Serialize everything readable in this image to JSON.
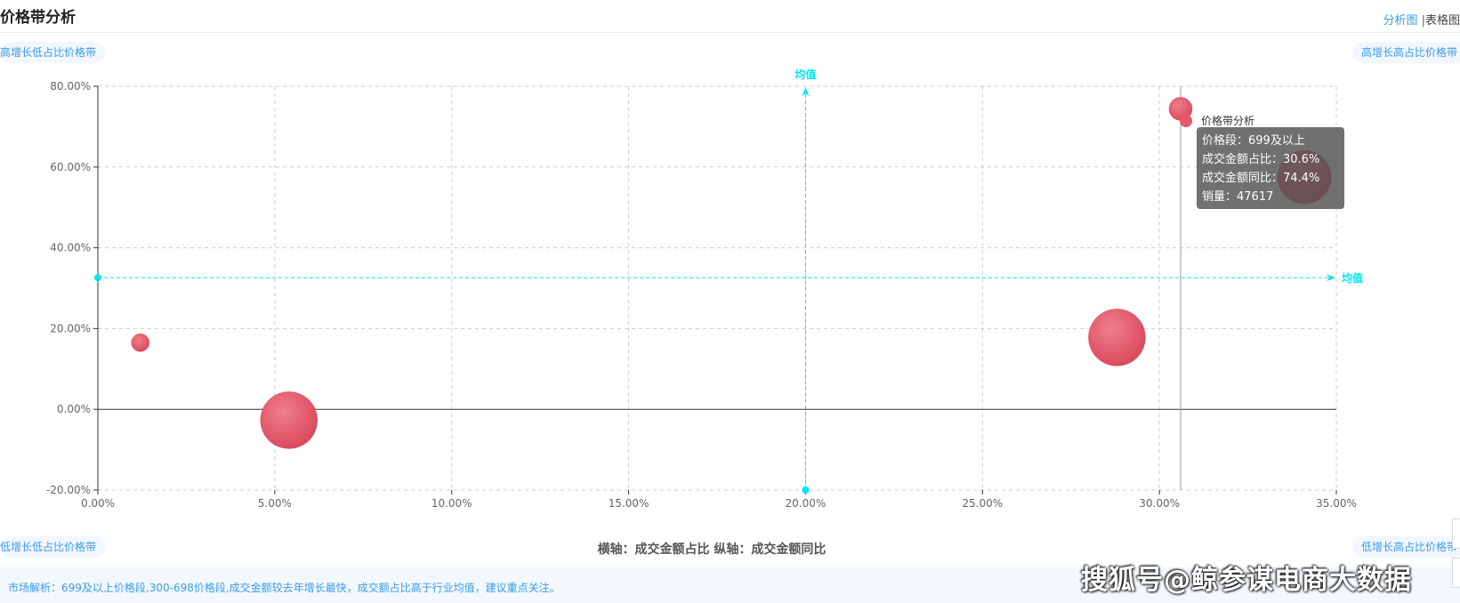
{
  "header": {
    "title": "价格带分析",
    "view_analysis": "分析图",
    "view_sep": "|",
    "view_table": "表格图"
  },
  "quadrants": {
    "top_left": "高增长低占比价格带",
    "top_right": "高增长高占比价格带",
    "bottom_left": "低增长低占比价格带",
    "bottom_right": "低增长高占比价格带"
  },
  "chart_data": {
    "type": "scatter",
    "bubble": true,
    "legend": {
      "label": "价格带分析",
      "position": "top-right"
    },
    "x_ticks": [
      "0.00%",
      "5.00%",
      "10.00%",
      "15.00%",
      "20.00%",
      "25.00%",
      "30.00%",
      "35.00%"
    ],
    "y_ticks": [
      "-20.00%",
      "0.00%",
      "20.00%",
      "40.00%",
      "60.00%",
      "80.00%"
    ],
    "xlim": [
      0,
      35
    ],
    "ylim": [
      -20,
      80
    ],
    "grid": true,
    "points": [
      {
        "x": 1.2,
        "y": 16.5,
        "size": 10
      },
      {
        "x": 5.4,
        "y": -2.7,
        "size": 32
      },
      {
        "x": 28.8,
        "y": 17.8,
        "size": 32
      },
      {
        "x": 30.6,
        "y": 74.4,
        "size": 13,
        "sales": 47617,
        "price_band": "699及以上"
      },
      {
        "x": 34.1,
        "y": 57.5,
        "size": 30
      }
    ],
    "mean_x": 20.0,
    "mean_y": 32.6,
    "mean_label": "均值",
    "hover_x": 30.6,
    "axis_caption": "横轴：成交金额占比  纵轴：成交金额同比",
    "colors": {
      "bubble": "#e6576a",
      "mean_line": "#00e5ee",
      "grid": "#cccccc",
      "axis": "#333333"
    }
  },
  "tooltip": {
    "line1": "价格段：699及以上",
    "line2": "成交金额占比：30.6%",
    "line3": "成交金额同比：74.4%",
    "line4": "销量：47617"
  },
  "footer": {
    "analysis": "市场解析：699及以上价格段,300-698价格段,成交金额较去年增长最快，成交额占比高于行业均值，建议重点关注。"
  },
  "watermark": "搜狐号@鲸参谋电商大数据"
}
